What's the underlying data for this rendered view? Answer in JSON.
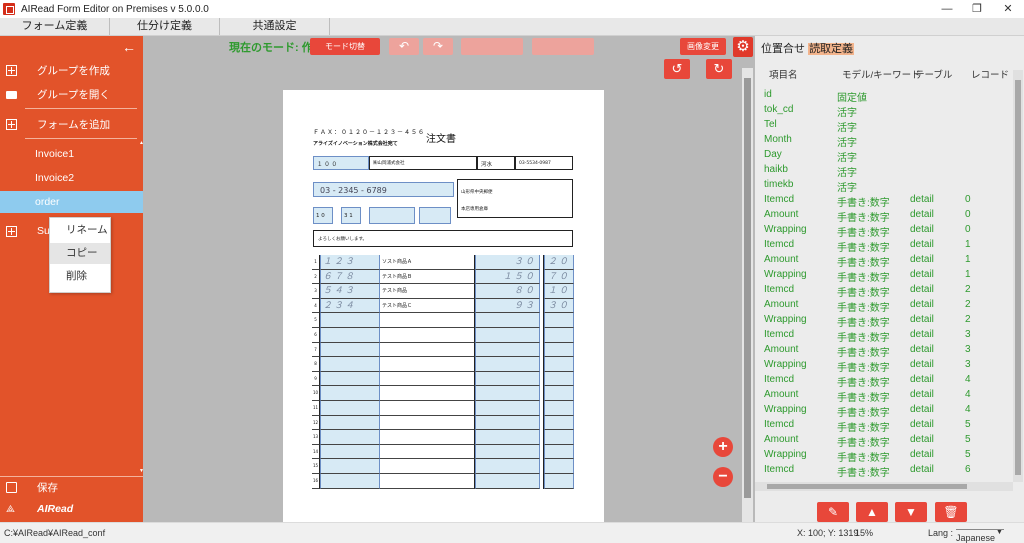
{
  "window": {
    "title": "AIRead Form Editor on Premises v 5.0.0.0",
    "minimize": "—",
    "maximize": "❐",
    "close": "✕"
  },
  "menu": {
    "tabs": [
      "フォーム定義",
      "仕分け定義",
      "共通設定"
    ]
  },
  "sidebar": {
    "back_icon": "←",
    "items": [
      {
        "label": "グループを作成",
        "icon": "plus-box-icon"
      },
      {
        "label": "グループを開く",
        "icon": "folder-open-icon"
      },
      {
        "label": "フォームを追加",
        "icon": "plus-box-icon"
      },
      {
        "label": "Invoice1",
        "icon": "document-icon"
      },
      {
        "label": "Invoice2",
        "icon": "document-icon"
      },
      {
        "label": "order",
        "icon": "document-icon"
      },
      {
        "label": "Sub",
        "icon": "plus-box-icon"
      }
    ],
    "save_label": "保存",
    "brand_label": "AIRead",
    "colors": {
      "background": "#e2532a",
      "selected": "#8ecbee"
    }
  },
  "context_menu": {
    "items": [
      "リネーム",
      "コピー",
      "削除"
    ],
    "hovered_index": 1
  },
  "toolbar": {
    "mode_label": "現在のモード: 作成",
    "mode_switch": "モード切替",
    "undo": "↶",
    "redo": "↷",
    "image_change": "画像変更",
    "gear_icon": "⚙",
    "rotate_left": "↺",
    "rotate_right": "↻",
    "zoom_in": "+",
    "zoom_out": "−"
  },
  "document": {
    "fax": "ＦＡＸ：０１２０－１２３－４５６",
    "title": "注文書",
    "company": "アライズイノベーション株式会社宛て",
    "customer_code": "１ ０ ０",
    "customer_name": "㈱山岡浦式会社",
    "person_name": "河水",
    "person_tel": "03-5534-0987",
    "tel": "03 - 2345 - 6789",
    "month": "1 0",
    "day": "3 1",
    "address": "山形県中央郵便",
    "delivery": "本店専用倉庫",
    "remarks": "よろしくお願いします。",
    "rows": [
      {
        "no": "1",
        "code": "１２３",
        "name": "ソスト商品Ａ",
        "qty": "３０",
        "price": "２０"
      },
      {
        "no": "2",
        "code": "６７８",
        "name": "テスト商品Ｂ",
        "qty": "１５０",
        "price": "７０"
      },
      {
        "no": "3",
        "code": "５４３",
        "name": "テスト商品",
        "qty": "８０",
        "price": "１００"
      },
      {
        "no": "4",
        "code": "２３４",
        "name": "テスト商品Ｃ",
        "qty": "９３",
        "price": "３０"
      },
      {
        "no": "5"
      },
      {
        "no": "6"
      },
      {
        "no": "7"
      },
      {
        "no": "8"
      },
      {
        "no": "9"
      },
      {
        "no": "10"
      },
      {
        "no": "11"
      },
      {
        "no": "12"
      },
      {
        "no": "13"
      },
      {
        "no": "14"
      },
      {
        "no": "15"
      },
      {
        "no": "16"
      }
    ]
  },
  "right_panel": {
    "tabs": [
      "位置合せ",
      "読取定義"
    ],
    "active_tab": 1,
    "headers": [
      "項目名",
      "モデル/キーワード",
      "テーブル",
      "レコード"
    ],
    "rows": [
      [
        "id",
        "固定値",
        "",
        ""
      ],
      [
        "tok_cd",
        "活字",
        "",
        ""
      ],
      [
        "Tel",
        "活字",
        "",
        ""
      ],
      [
        "Month",
        "活字",
        "",
        ""
      ],
      [
        "Day",
        "活字",
        "",
        ""
      ],
      [
        "haikb",
        "活字",
        "",
        ""
      ],
      [
        "timekb",
        "活字",
        "",
        ""
      ],
      [
        "Itemcd",
        "手書き:数字",
        "detail",
        "0"
      ],
      [
        "Amount",
        "手書き:数字",
        "detail",
        "0"
      ],
      [
        "Wrapping",
        "手書き:数字",
        "detail",
        "0"
      ],
      [
        "Itemcd",
        "手書き:数字",
        "detail",
        "1"
      ],
      [
        "Amount",
        "手書き:数字",
        "detail",
        "1"
      ],
      [
        "Wrapping",
        "手書き:数字",
        "detail",
        "1"
      ],
      [
        "Itemcd",
        "手書き:数字",
        "detail",
        "2"
      ],
      [
        "Amount",
        "手書き:数字",
        "detail",
        "2"
      ],
      [
        "Wrapping",
        "手書き:数字",
        "detail",
        "2"
      ],
      [
        "Itemcd",
        "手書き:数字",
        "detail",
        "3"
      ],
      [
        "Amount",
        "手書き:数字",
        "detail",
        "3"
      ],
      [
        "Wrapping",
        "手書き:数字",
        "detail",
        "3"
      ],
      [
        "Itemcd",
        "手書き:数字",
        "detail",
        "4"
      ],
      [
        "Amount",
        "手書き:数字",
        "detail",
        "4"
      ],
      [
        "Wrapping",
        "手書き:数字",
        "detail",
        "4"
      ],
      [
        "Itemcd",
        "手書き:数字",
        "detail",
        "5"
      ],
      [
        "Amount",
        "手書き:数字",
        "detail",
        "5"
      ],
      [
        "Wrapping",
        "手書き:数字",
        "detail",
        "5"
      ],
      [
        "Itemcd",
        "手書き:数字",
        "detail",
        "6"
      ]
    ],
    "actions": [
      "✎",
      "▲",
      "▼",
      "🗑"
    ]
  },
  "status": {
    "path": "C:¥AIRead¥AIRead_conf",
    "coords": "X: 100; Y: 1319",
    "zoom": "15%",
    "lang_label": "Lang :",
    "lang_value": "Japanese"
  }
}
